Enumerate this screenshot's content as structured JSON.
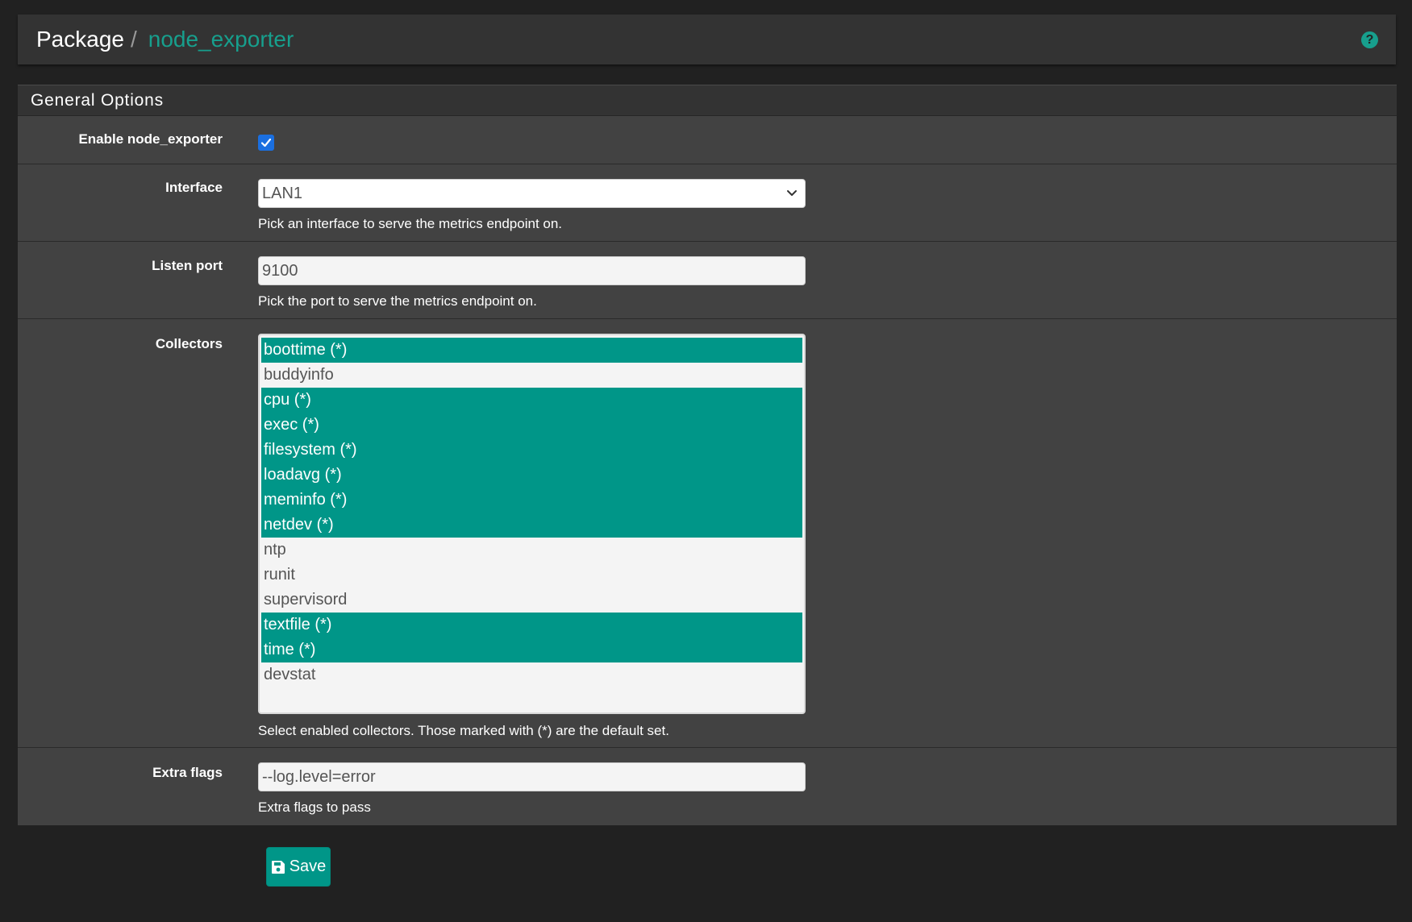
{
  "breadcrumb": {
    "root": "Package",
    "separator": "/",
    "current": "node_exporter"
  },
  "header": {
    "help_icon": "question-circle-icon"
  },
  "panel": {
    "title": "General Options"
  },
  "fields": {
    "enable": {
      "label": "Enable node_exporter",
      "checked": true
    },
    "interface": {
      "label": "Interface",
      "value": "LAN1",
      "help": "Pick an interface to serve the metrics endpoint on."
    },
    "listen_port": {
      "label": "Listen port",
      "value": "9100",
      "help": "Pick the port to serve the metrics endpoint on."
    },
    "collectors": {
      "label": "Collectors",
      "help": "Select enabled collectors. Those marked with (*) are the default set.",
      "options": [
        {
          "label": "boottime (*)",
          "selected": true
        },
        {
          "label": "buddyinfo",
          "selected": false
        },
        {
          "label": "cpu (*)",
          "selected": true
        },
        {
          "label": "exec (*)",
          "selected": true
        },
        {
          "label": "filesystem (*)",
          "selected": true
        },
        {
          "label": "loadavg (*)",
          "selected": true
        },
        {
          "label": "meminfo (*)",
          "selected": true
        },
        {
          "label": "netdev (*)",
          "selected": true
        },
        {
          "label": "ntp",
          "selected": false
        },
        {
          "label": "runit",
          "selected": false
        },
        {
          "label": "supervisord",
          "selected": false
        },
        {
          "label": "textfile (*)",
          "selected": true
        },
        {
          "label": "time (*)",
          "selected": true
        },
        {
          "label": "devstat",
          "selected": false
        }
      ]
    },
    "extra_flags": {
      "label": "Extra flags",
      "value": "--log.level=error",
      "help": "Extra flags to pass"
    }
  },
  "actions": {
    "save_label": "Save",
    "save_icon": "floppy-disk-icon"
  },
  "colors": {
    "background": "#212121",
    "panel": "#424242",
    "header": "#333333",
    "accent": "#009688",
    "checkbox": "#1a6fe0"
  }
}
